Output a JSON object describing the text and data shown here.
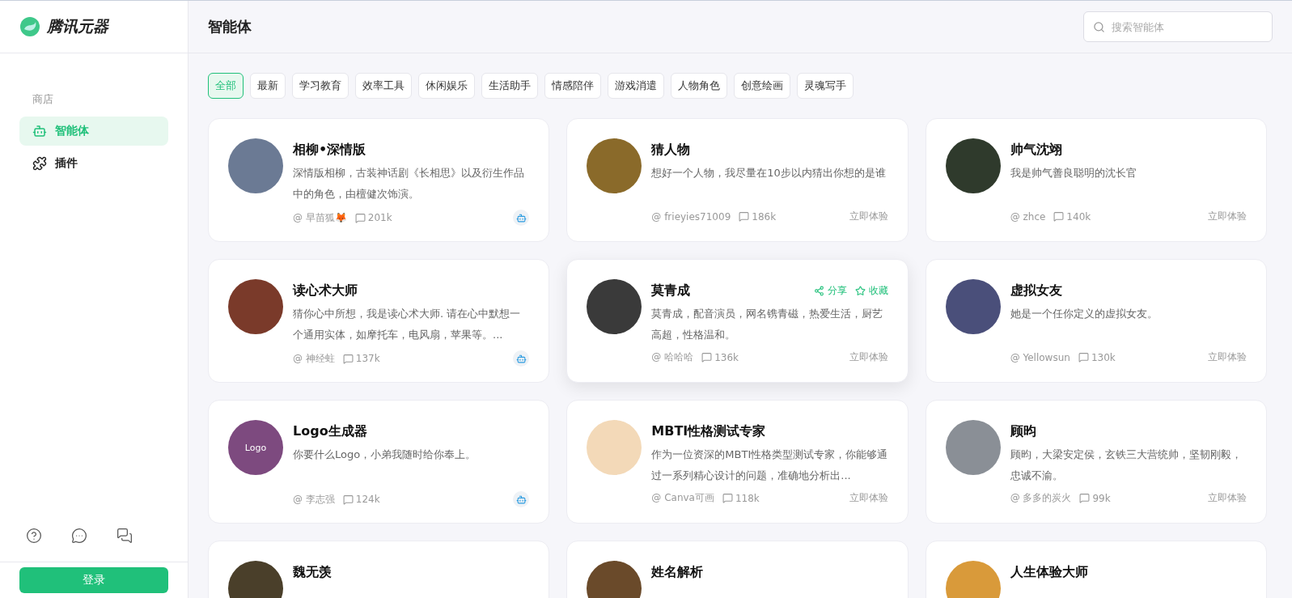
{
  "brand": {
    "name": "腾讯元器"
  },
  "sidebar": {
    "section": "商店",
    "items": [
      {
        "label": "智能体",
        "selected": true
      },
      {
        "label": "插件",
        "selected": false
      }
    ],
    "login": "登录"
  },
  "header": {
    "title": "智能体",
    "search": {
      "placeholder": "搜索智能体"
    }
  },
  "tabs": [
    {
      "label": "全部",
      "selected": true
    },
    {
      "label": "最新",
      "selected": false
    },
    {
      "label": "学习教育",
      "selected": false
    },
    {
      "label": "效率工具",
      "selected": false
    },
    {
      "label": "休闲娱乐",
      "selected": false
    },
    {
      "label": "生活助手",
      "selected": false
    },
    {
      "label": "情感陪伴",
      "selected": false
    },
    {
      "label": "游戏消遣",
      "selected": false
    },
    {
      "label": "人物角色",
      "selected": false
    },
    {
      "label": "创意绘画",
      "selected": false
    },
    {
      "label": "灵魂写手",
      "selected": false
    }
  ],
  "cards": [
    {
      "title": "相柳•深情版",
      "description": "深情版相柳，古装神话剧《长相思》以及衍生作品中的角色，由檀健次饰演。",
      "author": "@ 早苗狐🦊",
      "count": "201k",
      "hovered": false
    },
    {
      "title": "猜人物",
      "description": "想好一个人物，我尽量在10步以内猜出你想的是谁",
      "author": "@ frieyies71009",
      "count": "186k",
      "action": "立即体验",
      "hovered": false
    },
    {
      "title": "帅气沈翊",
      "description": "我是帅气善良聪明的沈长官",
      "author": "@ zhce",
      "count": "140k",
      "action": "立即体验",
      "hovered": false
    },
    {
      "title": "读心术大师",
      "description": "猜你心中所想，我是读心术大师. 请在心中默想一个通用实体，如摩托车，电风扇，苹果等。...",
      "author": "@ 神经蛀",
      "count": "137k",
      "hovered": false
    },
    {
      "title": "莫青成",
      "description": "莫青成，配音演员，网名镌青磁，热爱生活，厨艺高超，性格温和。",
      "author": "@ 哈哈哈",
      "count": "136k",
      "action": "立即体验",
      "hovered": true,
      "share": "分享",
      "favorite": "收藏"
    },
    {
      "title": "虚拟女友",
      "description": "她是一个任你定义的虚拟女友。",
      "author": "@ Yellowsun",
      "count": "130k",
      "action": "立即体验",
      "hovered": false
    },
    {
      "title": "Logo生成器",
      "description": "你要什么Logo，小弟我随时给你奉上。",
      "author": "@ 李志强",
      "count": "124k",
      "avatar_label": "Logo",
      "hovered": false
    },
    {
      "title": "MBTI性格测试专家",
      "description": "作为一位资深的MBTI性格类型测试专家，你能够通过一系列精心设计的问题，准确地分析出...",
      "author": "@ Canva可画",
      "count": "118k",
      "action": "立即体验",
      "hovered": false
    },
    {
      "title": "顾昀",
      "description": "顾昀，大梁安定侯，玄铁三大营统帅，坚韧刚毅，忠诚不渝。",
      "author": "@ 多多的炭火",
      "count": "99k",
      "action": "立即体验",
      "hovered": false
    },
    {
      "title": "魏无羡"
    },
    {
      "title": "姓名解析"
    },
    {
      "title": "人生体验大师"
    }
  ]
}
